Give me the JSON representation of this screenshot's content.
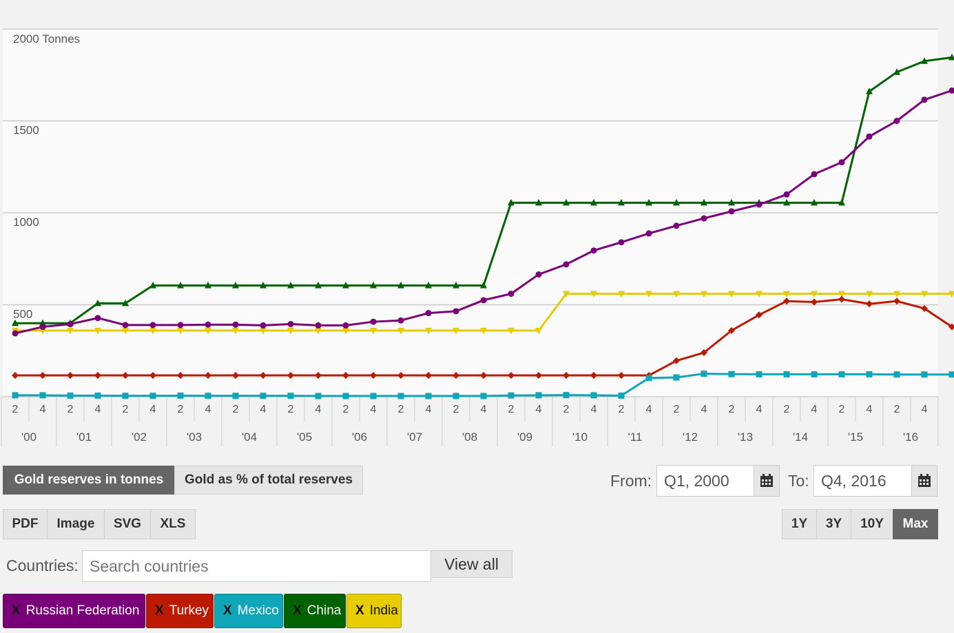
{
  "chart_data": {
    "type": "line",
    "y_unit_label": "2000 Tonnes",
    "yticks": [
      500,
      1000,
      1500
    ],
    "ylim": [
      0,
      2000
    ],
    "x_quarter_ticks": [
      "2",
      "4"
    ],
    "x_year_labels": [
      "'00",
      "'01",
      "'02",
      "'03",
      "'04",
      "'05",
      "'06",
      "'07",
      "'08",
      "'09",
      "'10",
      "'11",
      "'12",
      "'13",
      "'14",
      "'15",
      "'16"
    ],
    "x": [
      "Q1 2000",
      "Q2 2000",
      "Q4 2000",
      "Q2 2001",
      "Q4 2001",
      "Q2 2002",
      "Q4 2002",
      "Q2 2003",
      "Q4 2003",
      "Q2 2004",
      "Q4 2004",
      "Q2 2005",
      "Q4 2005",
      "Q2 2006",
      "Q4 2006",
      "Q2 2007",
      "Q4 2007",
      "Q2 2008",
      "Q4 2008",
      "Q2 2009",
      "Q4 2009",
      "Q2 2010",
      "Q4 2010",
      "Q2 2011",
      "Q4 2011",
      "Q2 2012",
      "Q4 2012",
      "Q2 2013",
      "Q4 2013",
      "Q2 2014",
      "Q4 2014",
      "Q2 2015",
      "Q4 2015",
      "Q2 2016",
      "Q4 2016"
    ],
    "series": [
      {
        "name": "Russian Federation",
        "color": "#7a007a",
        "marker": "circle",
        "values": [
          345,
          380,
          395,
          428,
          390,
          390,
          390,
          392,
          392,
          388,
          395,
          388,
          388,
          408,
          415,
          455,
          465,
          525,
          560,
          665,
          720,
          795,
          840,
          888,
          930,
          970,
          1008,
          1045,
          1100,
          1210,
          1275,
          1415,
          1500,
          1615,
          1665
        ]
      },
      {
        "name": "Turkey",
        "color": "#bb1a00",
        "marker": "diamond",
        "values": [
          116,
          116,
          116,
          116,
          116,
          116,
          116,
          116,
          116,
          116,
          116,
          116,
          116,
          116,
          116,
          116,
          116,
          116,
          116,
          116,
          116,
          116,
          116,
          116,
          196,
          240,
          360,
          445,
          520,
          515,
          530,
          505,
          520,
          480,
          380
        ]
      },
      {
        "name": "Mexico",
        "color": "#10a5b8",
        "marker": "square",
        "values": [
          8,
          8,
          6,
          6,
          5,
          5,
          6,
          5,
          5,
          5,
          5,
          4,
          4,
          4,
          4,
          4,
          4,
          4,
          7,
          8,
          9,
          8,
          6,
          102,
          105,
          125,
          123,
          122,
          122,
          122,
          122,
          122,
          121,
          121,
          121
        ]
      },
      {
        "name": "China",
        "color": "#006200",
        "marker": "triangle-up",
        "values": [
          400,
          400,
          400,
          508,
          508,
          605,
          605,
          605,
          605,
          605,
          605,
          605,
          605,
          605,
          605,
          605,
          605,
          605,
          1055,
          1055,
          1055,
          1055,
          1055,
          1055,
          1055,
          1055,
          1055,
          1055,
          1055,
          1055,
          1055,
          1660,
          1765,
          1825,
          1845
        ]
      },
      {
        "name": "India",
        "color": "#e6cc00",
        "marker": "triangle-down",
        "values": [
          360,
          360,
          360,
          360,
          360,
          360,
          360,
          360,
          360,
          360,
          360,
          360,
          360,
          360,
          360,
          360,
          360,
          360,
          360,
          360,
          560,
          560,
          560,
          560,
          560,
          560,
          560,
          560,
          560,
          560,
          560,
          560,
          560,
          560,
          560
        ]
      }
    ]
  },
  "toggle": {
    "tonnes": "Gold reserves in tonnes",
    "percent": "Gold as % of total reserves"
  },
  "exports": [
    "PDF",
    "Image",
    "SVG",
    "XLS"
  ],
  "ranges": [
    "1Y",
    "3Y",
    "10Y",
    "Max"
  ],
  "date": {
    "from_label": "From:",
    "from_value": "Q1, 2000",
    "to_label": "To:",
    "to_value": "Q4, 2016"
  },
  "countries": {
    "label": "Countries:",
    "placeholder": "Search countries",
    "view_all": "View all"
  },
  "chip_remove": "X",
  "chips": [
    {
      "name": "Russian Federation",
      "bg": "#7a007a",
      "fg": "#ffffff"
    },
    {
      "name": "Turkey",
      "bg": "#bb1a00",
      "fg": "#ffffff"
    },
    {
      "name": "Mexico",
      "bg": "#10a5b8",
      "fg": "#ffffff"
    },
    {
      "name": "China",
      "bg": "#006200",
      "fg": "#ffffff"
    },
    {
      "name": "India",
      "bg": "#e6cc00",
      "fg": "#111111"
    }
  ]
}
